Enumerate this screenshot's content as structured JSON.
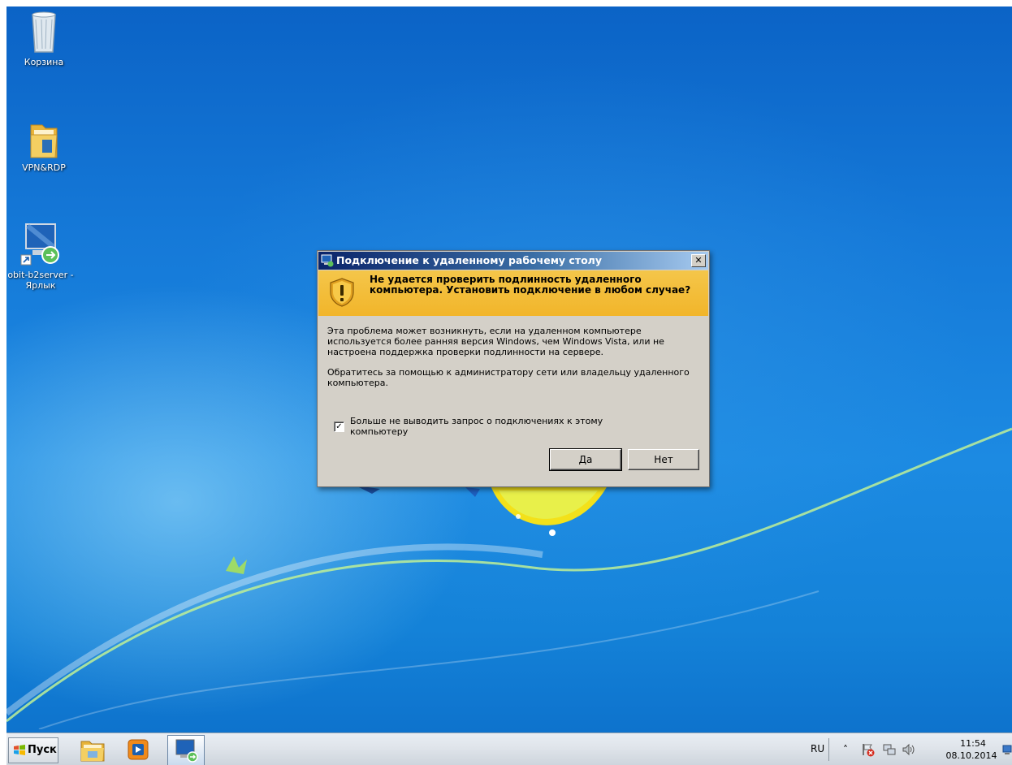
{
  "desktop": {
    "icons": [
      {
        "label": "Корзина"
      },
      {
        "label": "VPN&RDP"
      },
      {
        "label": "obit-b2server - Ярлык"
      }
    ]
  },
  "dialog": {
    "title": "Подключение к удаленному рабочему столу",
    "close_glyph": "✕",
    "heading": "Не удается проверить подлинность удаленного компьютера. Установить подключение в любом случае?",
    "paragraph1": "Эта проблема может возникнуть, если на удаленном компьютере используется более ранняя версия Windows, чем Windows Vista, или не настроена поддержка проверки подлинности на сервере.",
    "paragraph2": "Обратитесь за помощью к администратору сети или владельцу удаленного компьютера.",
    "checkbox_label": "Больше не выводить запрос о подключениях к этому компьютеру",
    "checkbox_checked": true,
    "checkbox_mark": "✓",
    "yes_label": "Да",
    "no_label": "Нет"
  },
  "taskbar": {
    "start_label": "Пуск",
    "pinned": [
      "explorer-icon",
      "media-player-icon",
      "remote-desktop-icon"
    ],
    "language": "RU",
    "tray_arrow": "˄",
    "time": "11:54",
    "date": "08.10.2014"
  },
  "colors": {
    "banner": "#f2b52a",
    "titlebar_start": "#0a246a",
    "titlebar_end": "#a6caf0",
    "dialog_bg": "#d4d0c8"
  }
}
